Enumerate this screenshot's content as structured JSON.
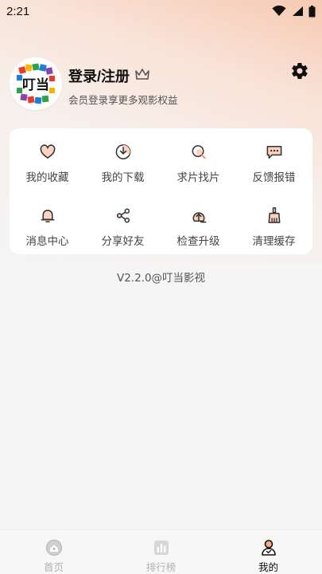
{
  "status_bar": {
    "time": "2:21"
  },
  "profile": {
    "avatar_text": "叮当",
    "login_label": "登录/注册",
    "subtitle": "会员登录享更多观影权益"
  },
  "menu": {
    "items": [
      {
        "label": "我的收藏",
        "icon": "heart-icon"
      },
      {
        "label": "我的下载",
        "icon": "download-icon"
      },
      {
        "label": "求片找片",
        "icon": "search-film-icon"
      },
      {
        "label": "反馈报错",
        "icon": "feedback-icon"
      },
      {
        "label": "消息中心",
        "icon": "bell-icon"
      },
      {
        "label": "分享好友",
        "icon": "share-icon"
      },
      {
        "label": "检查升级",
        "icon": "upgrade-icon"
      },
      {
        "label": "清理缓存",
        "icon": "broom-icon"
      }
    ]
  },
  "version": "V2.2.0@叮当影视",
  "tabs": [
    {
      "label": "首页",
      "icon": "home-icon",
      "active": false
    },
    {
      "label": "排行榜",
      "icon": "ranking-icon",
      "active": false
    },
    {
      "label": "我的",
      "icon": "profile-icon",
      "active": true
    }
  ],
  "colors": {
    "accent": "#f28a5e",
    "accent_light": "#fbd2bf",
    "icon_dark": "#333333"
  }
}
